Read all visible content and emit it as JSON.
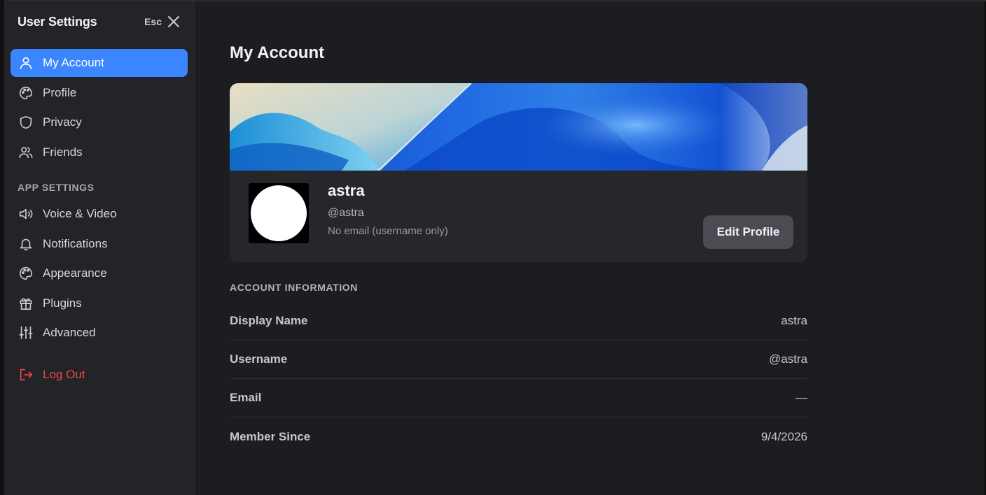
{
  "sidebar": {
    "title": "User Settings",
    "esc_label": "Esc",
    "user_items": [
      {
        "label": "My Account",
        "icon": "user-icon",
        "active": true
      },
      {
        "label": "Profile",
        "icon": "palette-icon"
      },
      {
        "label": "Privacy",
        "icon": "shield-icon"
      },
      {
        "label": "Friends",
        "icon": "users-icon"
      }
    ],
    "app_settings_label": "APP SETTINGS",
    "app_items": [
      {
        "label": "Voice & Video",
        "icon": "speaker-icon"
      },
      {
        "label": "Notifications",
        "icon": "bell-icon"
      },
      {
        "label": "Appearance",
        "icon": "palette-icon"
      },
      {
        "label": "Plugins",
        "icon": "gift-icon"
      },
      {
        "label": "Advanced",
        "icon": "sliders-icon"
      }
    ],
    "logout_label": "Log Out"
  },
  "main": {
    "title": "My Account",
    "profile": {
      "display_name": "astra",
      "handle": "@astra",
      "email_note": "No email (username only)",
      "edit_button": "Edit Profile"
    },
    "account_info_label": "ACCOUNT INFORMATION",
    "rows": [
      {
        "key": "Display Name",
        "value": "astra"
      },
      {
        "key": "Username",
        "value": "@astra"
      },
      {
        "key": "Email",
        "value": "—"
      },
      {
        "key": "Member Since",
        "value": "9/4/2026"
      }
    ]
  },
  "colors": {
    "accent": "#3b86ff",
    "danger": "#f24646",
    "sidebar_bg": "#232427",
    "main_bg": "#1c1d20"
  }
}
